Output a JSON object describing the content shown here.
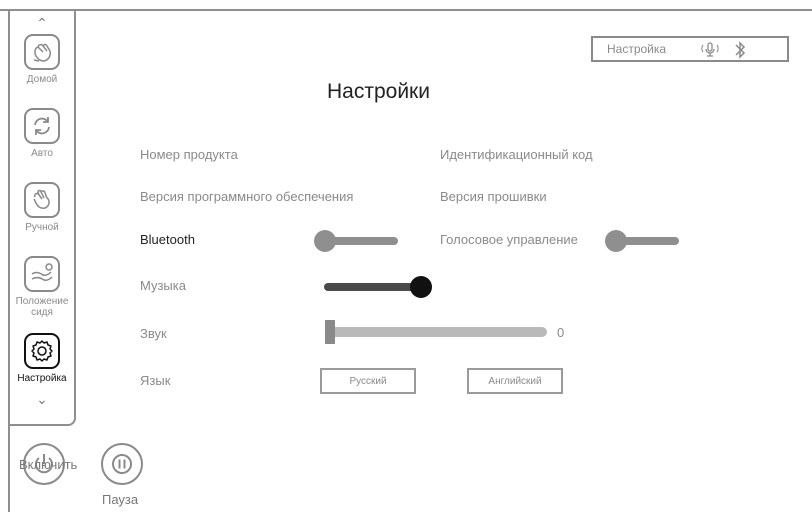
{
  "sidebar": {
    "items": [
      {
        "label": "Домой",
        "icon": "hand-wave-icon"
      },
      {
        "label": "Авто",
        "icon": "refresh-icon"
      },
      {
        "label": "Ручной",
        "icon": "hand-icon"
      },
      {
        "label": "Положение сидя",
        "icon": "seat-icon"
      },
      {
        "label": "Настройка",
        "icon": "gear-icon"
      }
    ],
    "active_index": 4
  },
  "status": {
    "label": "Настройка",
    "mic_icon": "mic-icon",
    "bt_icon": "bluetooth-icon"
  },
  "title": "Настройки",
  "info": {
    "product_number": "Номер продукта",
    "id_code": "Идентификационный код",
    "software_version": "Версия программного обеспечения",
    "firmware_version": "Версия прошивки"
  },
  "settings": {
    "bluetooth": {
      "label": "Bluetooth",
      "on": false
    },
    "voice": {
      "label": "Голосовое управление",
      "on": false
    },
    "music": {
      "label": "Музыка",
      "on": true
    },
    "sound": {
      "label": "Звук",
      "value": 0,
      "max": 100
    },
    "language": {
      "label": "Язык",
      "options": [
        "Русский",
        "Английский"
      ]
    }
  },
  "controls": {
    "power_label": "Включить",
    "pause_label": "Пауза"
  },
  "colors": {
    "active": "#111111",
    "inactive": "#8f8f8f",
    "text": "#8a8a8a"
  }
}
